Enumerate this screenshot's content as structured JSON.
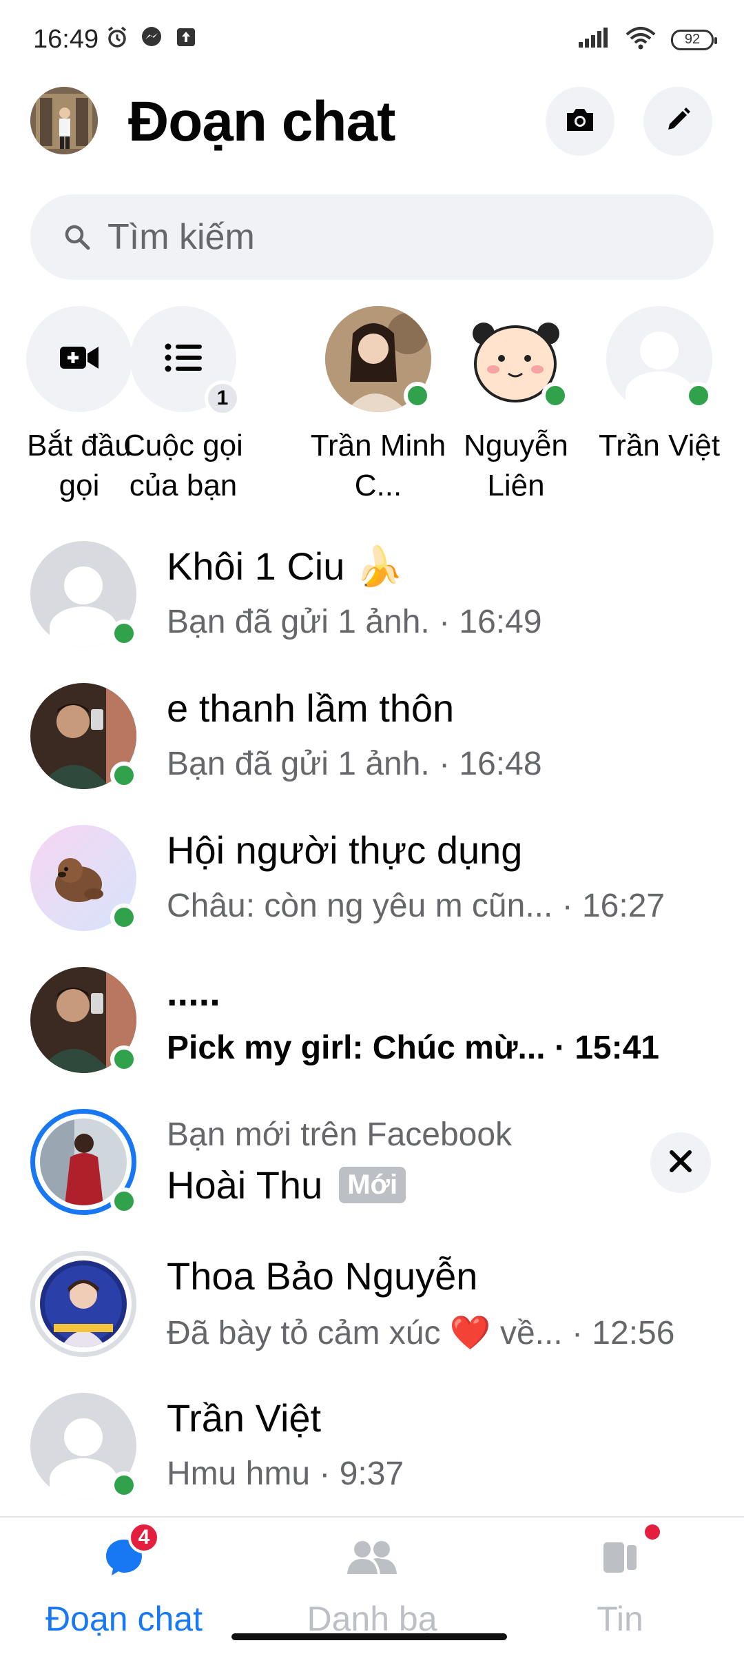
{
  "status_bar": {
    "time": "16:49",
    "battery": "92",
    "icons_left": [
      "alarm-icon",
      "messenger-icon",
      "upload-icon"
    ],
    "icons_right": [
      "signal-icon",
      "wifi-icon",
      "battery-icon"
    ]
  },
  "header": {
    "title": "Đoạn chat",
    "buttons": [
      "camera-icon",
      "compose-icon"
    ]
  },
  "search": {
    "placeholder": "Tìm kiếm"
  },
  "active_row": [
    {
      "label": "Bắt đầu gọi",
      "icon": "video-plus-icon"
    },
    {
      "label": "Cuộc gọi của bạn",
      "icon": "list-icon",
      "count": "1"
    },
    {
      "label": "Trần Minh C...",
      "online": true
    },
    {
      "label": "Nguyễn Liên",
      "online": true
    },
    {
      "label": "Trần Việt",
      "online": true
    }
  ],
  "chats": [
    {
      "name": "Khôi 1 Ciu 🍌",
      "preview": "Bạn đã gửi 1 ảnh. · 16:49",
      "online": true
    },
    {
      "name": "e thanh lầm thôn",
      "preview": "Bạn đã gửi 1 ảnh. · 16:48",
      "online": true
    },
    {
      "name": "Hội người thực dụng",
      "preview": "Châu: còn ng yêu m cũn...  · 16:27",
      "online": true
    },
    {
      "name": ".....",
      "preview": "Pick my girl: Chúc mừ... · 15:41",
      "online": true,
      "unread": true
    },
    {
      "subtitle": "Bạn mới trên Facebook",
      "name": "Hoài Thu",
      "badge": "Mới",
      "online": true
    },
    {
      "name": "Thoa Bảo Nguyễn",
      "preview": "Đã bày tỏ cảm xúc ❤️ về... · 12:56"
    },
    {
      "name": "Trần Việt",
      "preview": "Hmu hmu · 9:37",
      "online": true
    }
  ],
  "bottom_nav": [
    {
      "label": "Đoạn chat",
      "icon": "chat-bubble-icon",
      "badge": "4",
      "active": true
    },
    {
      "label": "Danh bạ",
      "icon": "people-icon"
    },
    {
      "label": "Tin",
      "icon": "stories-icon",
      "dot": true
    }
  ],
  "colors": {
    "accent": "#1877f2",
    "online": "#31a24c",
    "badge": "#e41e3f",
    "secondary_text": "#65676b"
  }
}
